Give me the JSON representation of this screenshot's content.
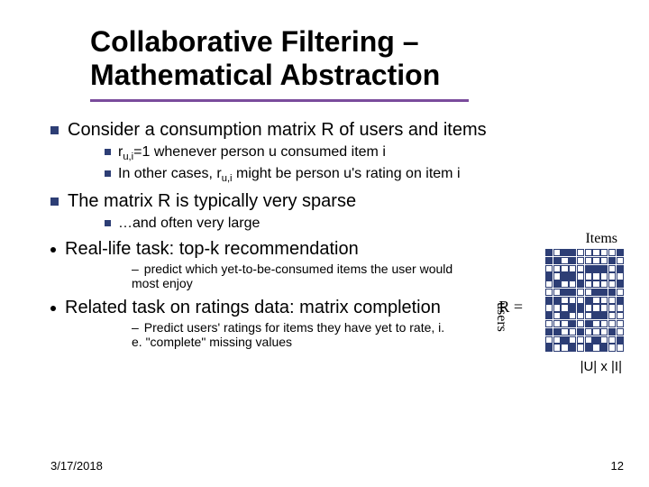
{
  "title_line1": "Collaborative Filtering –",
  "title_line2": "Mathematical Abstraction",
  "bullets": {
    "b1": "Consider a consumption matrix R of users and items",
    "b1a_pre": "r",
    "b1a_sub": "u,i",
    "b1a_post": "=1 whenever person u consumed item i",
    "b1b_pre": "In other cases, r",
    "b1b_sub": "u,i",
    "b1b_post": " might be person u's rating on item i",
    "b2": "The matrix R is typically very sparse",
    "b2a": "…and often very large",
    "b3": "Real-life task: top-k recommendation",
    "b3a": "predict which yet-to-be-consumed items the user would most enjoy",
    "b4": "Related task on ratings data: matrix completion",
    "b4a": "Predict users' ratings for items they have yet to rate, i. e. \"complete\" missing values"
  },
  "labels": {
    "items": "Items",
    "users": "users",
    "r_eq": "R =",
    "dim": "|U| x |I|"
  },
  "footer": {
    "date": "3/17/2018",
    "page": "12"
  },
  "matrix": {
    "rows": 13,
    "cols": 10,
    "filled": [
      [
        0,
        0
      ],
      [
        0,
        2
      ],
      [
        0,
        3
      ],
      [
        0,
        9
      ],
      [
        1,
        0
      ],
      [
        1,
        1
      ],
      [
        1,
        3
      ],
      [
        1,
        8
      ],
      [
        2,
        5
      ],
      [
        2,
        6
      ],
      [
        2,
        7
      ],
      [
        2,
        9
      ],
      [
        3,
        0
      ],
      [
        3,
        2
      ],
      [
        3,
        3
      ],
      [
        4,
        1
      ],
      [
        4,
        4
      ],
      [
        4,
        9
      ],
      [
        5,
        2
      ],
      [
        5,
        3
      ],
      [
        5,
        6
      ],
      [
        5,
        7
      ],
      [
        5,
        8
      ],
      [
        6,
        0
      ],
      [
        6,
        1
      ],
      [
        6,
        5
      ],
      [
        6,
        9
      ],
      [
        7,
        3
      ],
      [
        7,
        4
      ],
      [
        8,
        0
      ],
      [
        8,
        2
      ],
      [
        8,
        6
      ],
      [
        8,
        7
      ],
      [
        9,
        3
      ],
      [
        9,
        5
      ],
      [
        10,
        0
      ],
      [
        10,
        1
      ],
      [
        10,
        4
      ],
      [
        10,
        8
      ],
      [
        11,
        2
      ],
      [
        11,
        6
      ],
      [
        11,
        9
      ],
      [
        12,
        0
      ],
      [
        12,
        3
      ],
      [
        12,
        5
      ],
      [
        12,
        7
      ]
    ]
  }
}
